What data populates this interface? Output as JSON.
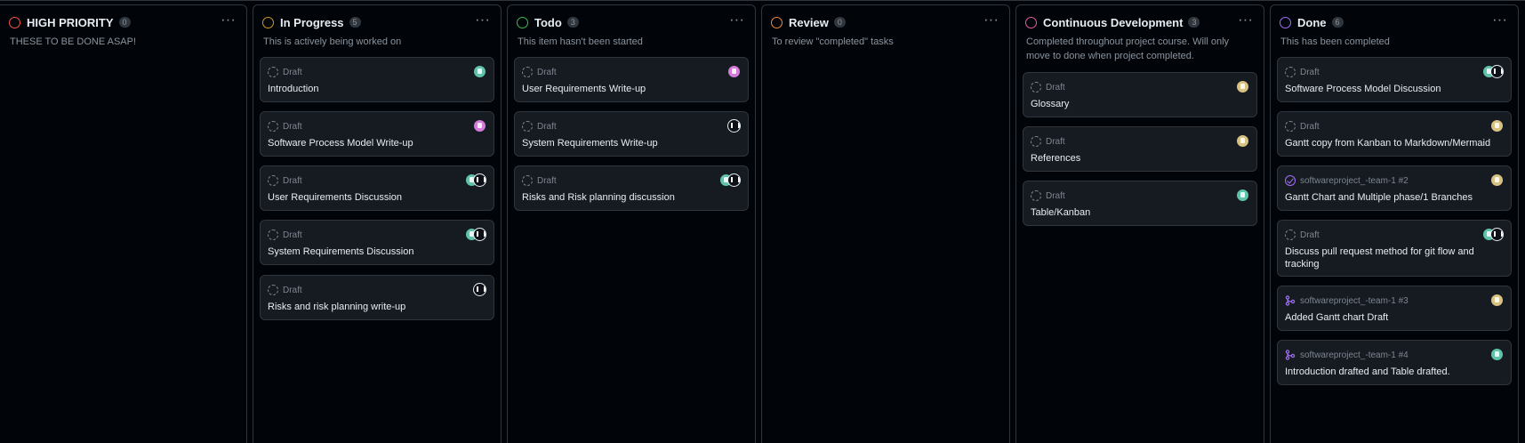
{
  "draft_label": "Draft",
  "columns": [
    {
      "title": "HIGH PRIORITY",
      "count": "0",
      "description": "THESE TO BE DONE ASAP!",
      "status_color": "#f85149"
    },
    {
      "title": "In Progress",
      "count": "5",
      "description": "This is actively being worked on",
      "status_color": "#d29922"
    },
    {
      "title": "Todo",
      "count": "3",
      "description": "This item hasn't been started",
      "status_color": "#3fb950"
    },
    {
      "title": "Review",
      "count": "0",
      "description": "To review \"completed\" tasks",
      "status_color": "#f0883e"
    },
    {
      "title": "Continuous Development",
      "count": "3",
      "description": "Completed throughout project course. Will only move to done when project completed.",
      "status_color": "#db61a2"
    },
    {
      "title": "Done",
      "count": "6",
      "description": "This has been completed",
      "status_color": "#a371f7"
    }
  ],
  "cards": {
    "in_progress": [
      {
        "title": "Introduction",
        "assignees": [
          "teal-avatar"
        ]
      },
      {
        "title": "Software Process Model Write-up",
        "assignees": [
          "pink-avatar"
        ]
      },
      {
        "title": "User Requirements Discussion",
        "assignees": [
          "teal-avatar",
          "dark-avatar"
        ]
      },
      {
        "title": "System Requirements Discussion",
        "assignees": [
          "teal-avatar",
          "dark-avatar"
        ]
      },
      {
        "title": "Risks and risk planning write-up",
        "assignees": [
          "dark-avatar"
        ]
      }
    ],
    "todo": [
      {
        "title": "User Requirements Write-up",
        "assignees": [
          "pink-avatar"
        ]
      },
      {
        "title": "System Requirements Write-up",
        "assignees": [
          "dark-avatar"
        ]
      },
      {
        "title": "Risks and Risk planning discussion",
        "assignees": [
          "teal-avatar",
          "dark-avatar"
        ]
      }
    ],
    "continuous": [
      {
        "title": "Glossary",
        "assignees": [
          "gold-avatar"
        ]
      },
      {
        "title": "References",
        "assignees": [
          "gold-avatar"
        ]
      },
      {
        "title": "Table/Kanban",
        "assignees": [
          "teal-avatar"
        ]
      }
    ],
    "done": [
      {
        "type": "draft",
        "title": "Software Process Model Discussion",
        "assignees": [
          "teal-avatar",
          "dark-avatar"
        ]
      },
      {
        "type": "draft",
        "title": "Gantt copy from Kanban to Markdown/Mermaid",
        "assignees": [
          "gold-avatar"
        ]
      },
      {
        "type": "issue",
        "repo": "softwareproject_-team-1",
        "number": "#2",
        "title": "Gantt Chart and Multiple phase/1 Branches",
        "assignees": [
          "gold-avatar"
        ]
      },
      {
        "type": "draft",
        "title": "Discuss pull request method for git flow and tracking",
        "assignees": [
          "teal-avatar",
          "dark-avatar"
        ]
      },
      {
        "type": "pr",
        "repo": "softwareproject_-team-1",
        "number": "#3",
        "title": "Added Gantt chart Draft",
        "assignees": [
          "gold-avatar"
        ]
      },
      {
        "type": "pr",
        "repo": "softwareproject_-team-1",
        "number": "#4",
        "title": "Introduction drafted and Table drafted.",
        "assignees": [
          "teal-avatar"
        ]
      }
    ]
  },
  "colors": {
    "background": "#010409",
    "card": "#161b22",
    "border": "#30363d",
    "muted": "#8b949e",
    "text": "#e6edf3"
  }
}
